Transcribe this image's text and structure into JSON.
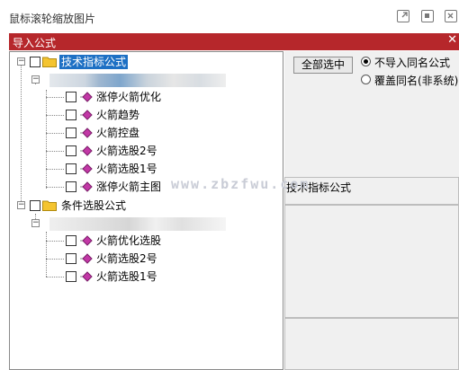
{
  "app": {
    "title": "鼠标滚轮缩放图片",
    "icons": [
      "external-link-icon",
      "restore-icon",
      "close-box-icon"
    ]
  },
  "dialog": {
    "title": "导入公式",
    "close_glyph": "✕"
  },
  "tree": {
    "groups": [
      {
        "label": "技术指标公式",
        "selected": true,
        "items": [
          "涨停火箭优化",
          "火箭趋势",
          "火箭控盘",
          "火箭选股2号",
          "火箭选股1号",
          "涨停火箭主图"
        ]
      },
      {
        "label": "条件选股公式",
        "selected": false,
        "items": [
          "火箭优化选股",
          "火箭选股2号",
          "火箭选股1号"
        ]
      }
    ]
  },
  "right": {
    "select_all_button": "全部选中",
    "radio_options": [
      {
        "label": "不导入同名公式",
        "checked": true
      },
      {
        "label": "覆盖同名(非系统)",
        "checked": false
      }
    ],
    "info_title": "技术指标公式"
  },
  "watermark": "www.zbzfwu.com",
  "colors": {
    "titlebar": "#b6272b",
    "selection": "#1d70c4",
    "panel_bg": "#f0f0f0"
  }
}
